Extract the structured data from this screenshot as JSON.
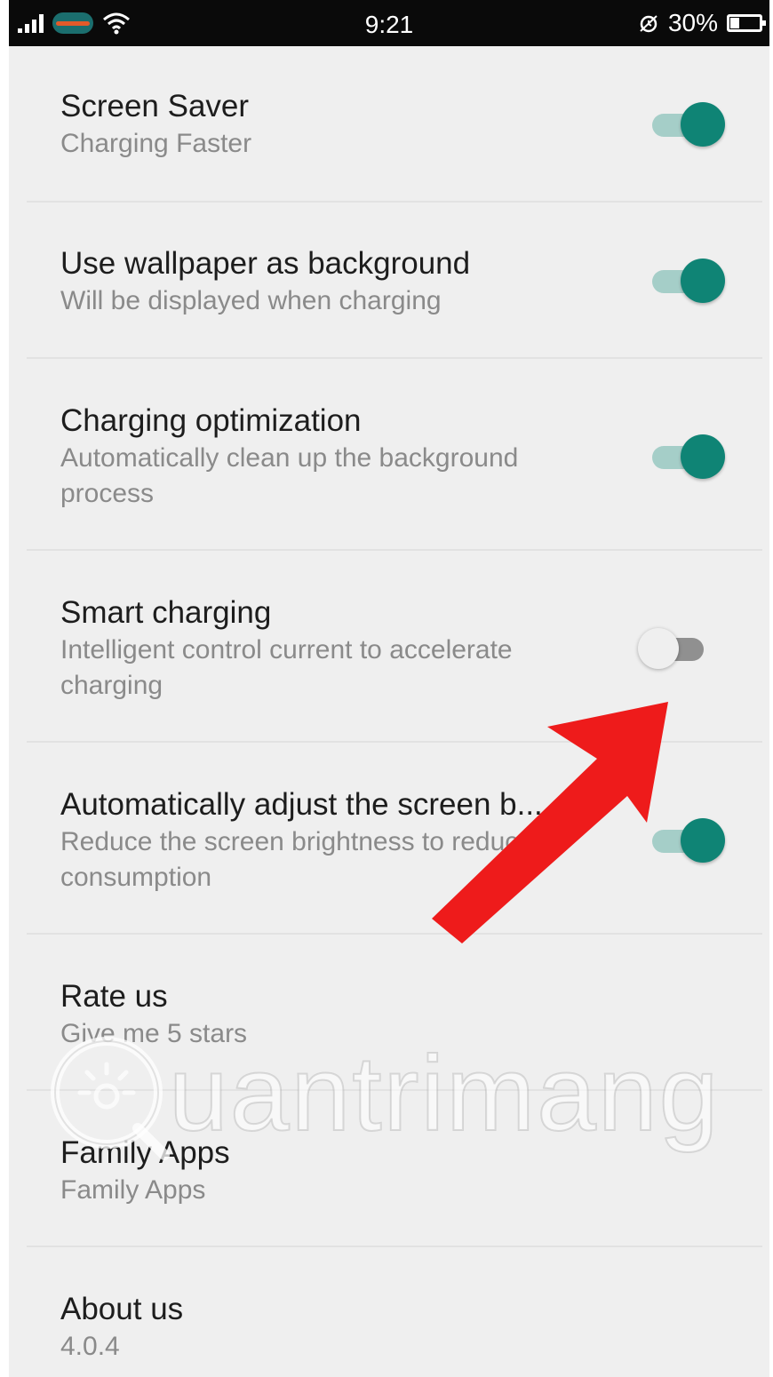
{
  "status_bar": {
    "time": "9:21",
    "battery_text": "30%",
    "battery_level": 0.3,
    "icons": [
      "signal-icon",
      "carrier-icon",
      "wifi-icon",
      "alarm-icon",
      "battery-icon"
    ]
  },
  "settings": [
    {
      "title": "Screen Saver",
      "subtitle": "Charging Faster",
      "toggle": "on"
    },
    {
      "title": "Use wallpaper as background",
      "subtitle": "Will be displayed when charging",
      "toggle": "on"
    },
    {
      "title": "Charging optimization",
      "subtitle": "Automatically clean up the background process",
      "toggle": "on"
    },
    {
      "title": "Smart charging",
      "subtitle": "Intelligent control current to accelerate charging",
      "toggle": "off"
    },
    {
      "title": "Automatically adjust the screen b...",
      "subtitle": "Reduce the screen brightness to reduce consumption",
      "toggle": "on"
    },
    {
      "title": "Rate us",
      "subtitle": "Give me 5 stars"
    },
    {
      "title": "Family Apps",
      "subtitle": "Family Apps"
    },
    {
      "title": "About us",
      "subtitle": "4.0.4"
    }
  ],
  "watermark_text": "uantrimang",
  "colors": {
    "accent": "#0f8475",
    "accent_track": "#a5cec8",
    "arrow": "#ee1b1b",
    "background": "#efefef"
  }
}
